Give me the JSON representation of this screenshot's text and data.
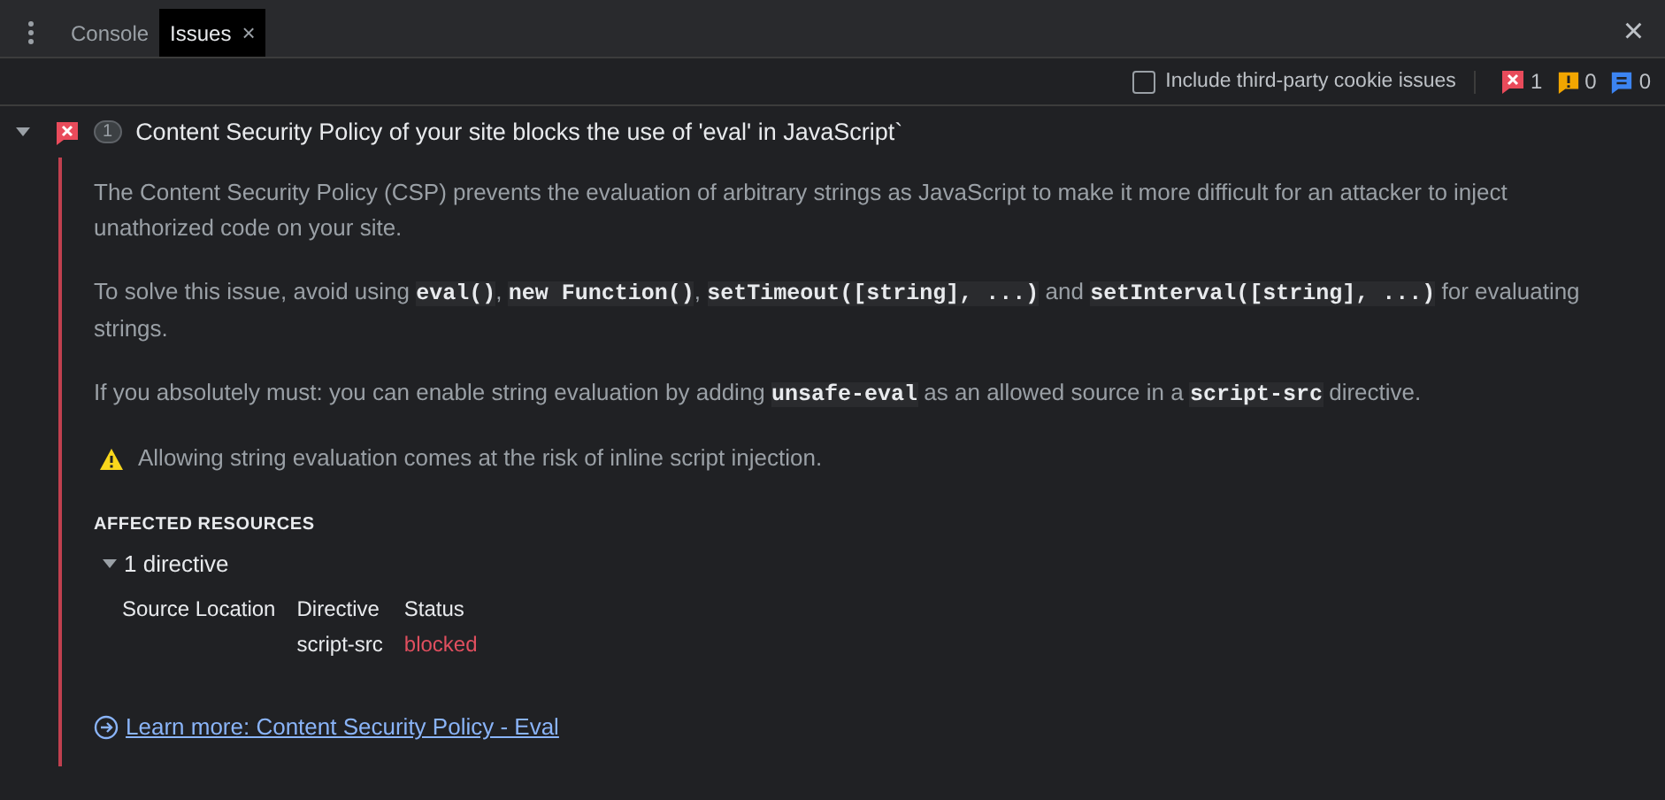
{
  "tabs": [
    {
      "label": "Console",
      "selected": false
    },
    {
      "label": "Issues",
      "selected": true,
      "close_icon": "×"
    }
  ],
  "close_panel": "×",
  "toolbar": {
    "checkbox": {
      "label": "Include third-party cookie issues",
      "checked": false
    },
    "counts": [
      {
        "kind": "error",
        "count": "1"
      },
      {
        "kind": "warning",
        "count": "0"
      },
      {
        "kind": "info",
        "count": "0"
      }
    ]
  },
  "issue": {
    "expanded": true,
    "kind": "error",
    "count": "1",
    "title": "Content Security Policy of your site blocks the use of 'eval' in JavaScript`",
    "paragraphs": [
      [
        {
          "kind": "text",
          "text": "The Content Security Policy (CSP) prevents the evaluation of arbitrary strings as JavaScript to make it more difficult for an attacker to inject unathorized code on your site."
        }
      ],
      [
        {
          "kind": "text",
          "text": "To solve this issue, avoid using "
        },
        {
          "kind": "code",
          "text": "eval()"
        },
        {
          "kind": "text",
          "text": ", "
        },
        {
          "kind": "code",
          "text": "new Function()"
        },
        {
          "kind": "text",
          "text": ", "
        },
        {
          "kind": "code",
          "text": "setTimeout([string], ...)"
        },
        {
          "kind": "text",
          "text": " and "
        },
        {
          "kind": "code",
          "text": "setInterval([string], ...)"
        },
        {
          "kind": "text",
          "text": " for evaluating strings."
        }
      ],
      [
        {
          "kind": "text",
          "text": "If you absolutely must: you can enable string evaluation by adding "
        },
        {
          "kind": "code",
          "text": "unsafe-eval"
        },
        {
          "kind": "text",
          "text": " as an allowed source in a "
        },
        {
          "kind": "code",
          "text": "script-src"
        },
        {
          "kind": "text",
          "text": " directive."
        }
      ]
    ],
    "warning": "Allowing string evaluation comes at the risk of inline script injection.",
    "affected_heading": "AFFECTED RESOURCES",
    "group": {
      "label": "1 directive",
      "expanded": true,
      "columns": [
        "Source Location",
        "Directive",
        "Status"
      ],
      "rows": [
        {
          "cells": [
            "",
            "script-src",
            "blocked"
          ]
        }
      ]
    },
    "link": "Learn more: Content Security Policy - Eval"
  }
}
